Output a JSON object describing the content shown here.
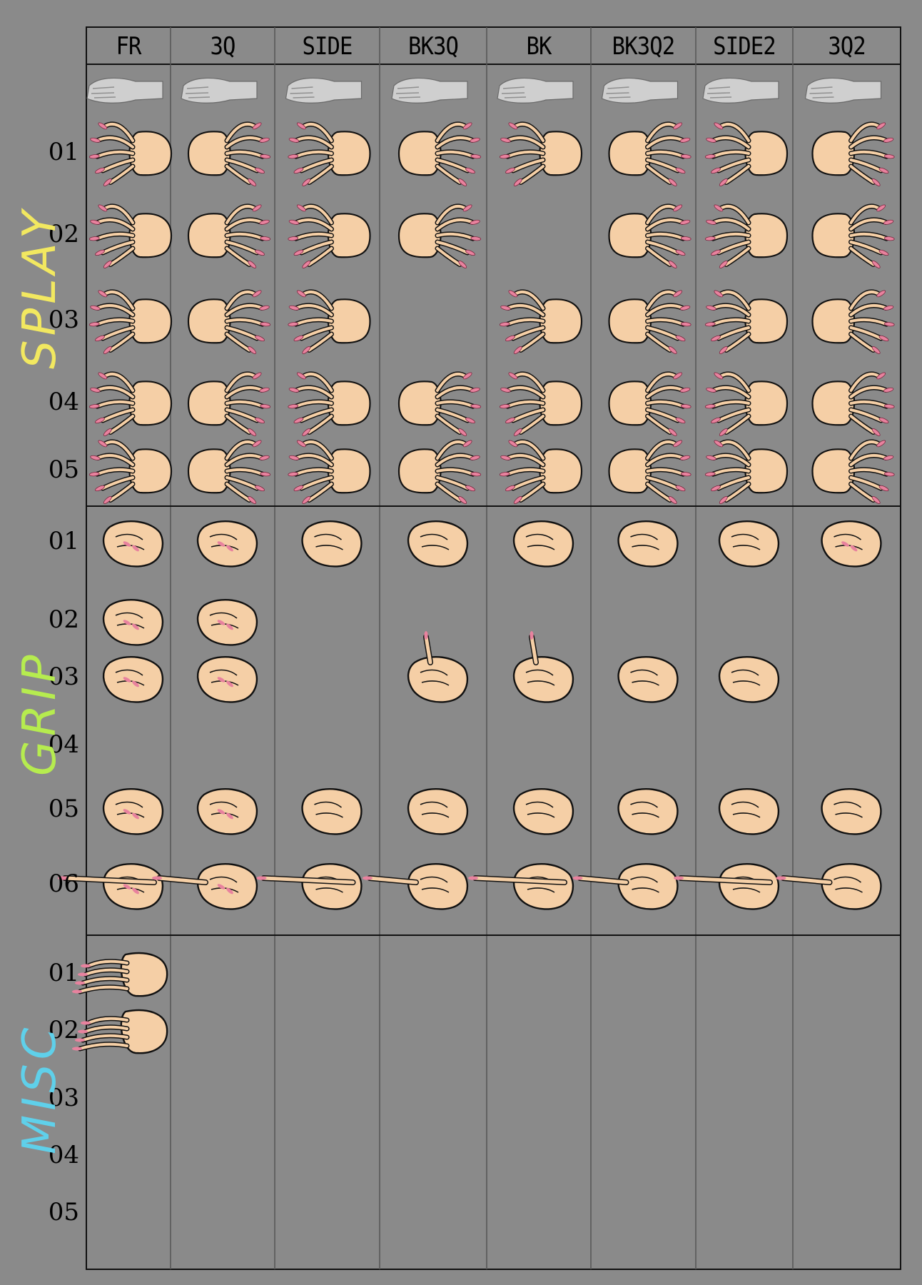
{
  "columns": [
    "FR",
    "3Q",
    "SIDE",
    "BK3Q",
    "BK",
    "BK3Q2",
    "SIDE2",
    "3Q2"
  ],
  "sections": [
    {
      "label": "SPLAY",
      "color": "#f2e860",
      "rows": [
        "01",
        "02",
        "03",
        "04",
        "05"
      ],
      "cells": [
        [
          1,
          1,
          1,
          1,
          1,
          1,
          1,
          1
        ],
        [
          1,
          1,
          1,
          1,
          0,
          1,
          1,
          1
        ],
        [
          1,
          1,
          1,
          0,
          1,
          1,
          1,
          1
        ],
        [
          1,
          1,
          1,
          1,
          1,
          1,
          1,
          1
        ],
        [
          1,
          1,
          1,
          1,
          1,
          1,
          1,
          1
        ]
      ]
    },
    {
      "label": "GRIP",
      "color": "#b6ec4f",
      "rows": [
        "01",
        "02",
        "03",
        "04",
        "05",
        "06"
      ],
      "cells": [
        [
          1,
          1,
          1,
          1,
          1,
          1,
          1,
          1
        ],
        [
          1,
          1,
          0,
          0,
          0,
          0,
          0,
          0
        ],
        [
          1,
          1,
          0,
          1,
          1,
          1,
          1,
          0
        ],
        [
          0,
          0,
          0,
          0,
          0,
          0,
          0,
          0
        ],
        [
          1,
          1,
          1,
          1,
          1,
          1,
          1,
          1
        ],
        [
          1,
          1,
          1,
          1,
          1,
          1,
          1,
          1
        ]
      ]
    },
    {
      "label": "MISC",
      "color": "#5fd0ea",
      "rows": [
        "01",
        "02",
        "03",
        "04",
        "05"
      ],
      "cells": [
        [
          1,
          0,
          0,
          0,
          0,
          0,
          0,
          0
        ],
        [
          1,
          0,
          0,
          0,
          0,
          0,
          0,
          0
        ],
        [
          0,
          0,
          0,
          0,
          0,
          0,
          0,
          0
        ],
        [
          0,
          0,
          0,
          0,
          0,
          0,
          0,
          0
        ],
        [
          0,
          0,
          0,
          0,
          0,
          0,
          0,
          0
        ]
      ]
    }
  ],
  "reference_row": "reference-hand-photos",
  "colors": {
    "skin": "#f5cfa6",
    "nail": "#e8829e",
    "ink": "#111111",
    "grid": "#111111",
    "background": "#8a8a8a",
    "reference": "#cfcfcf"
  }
}
